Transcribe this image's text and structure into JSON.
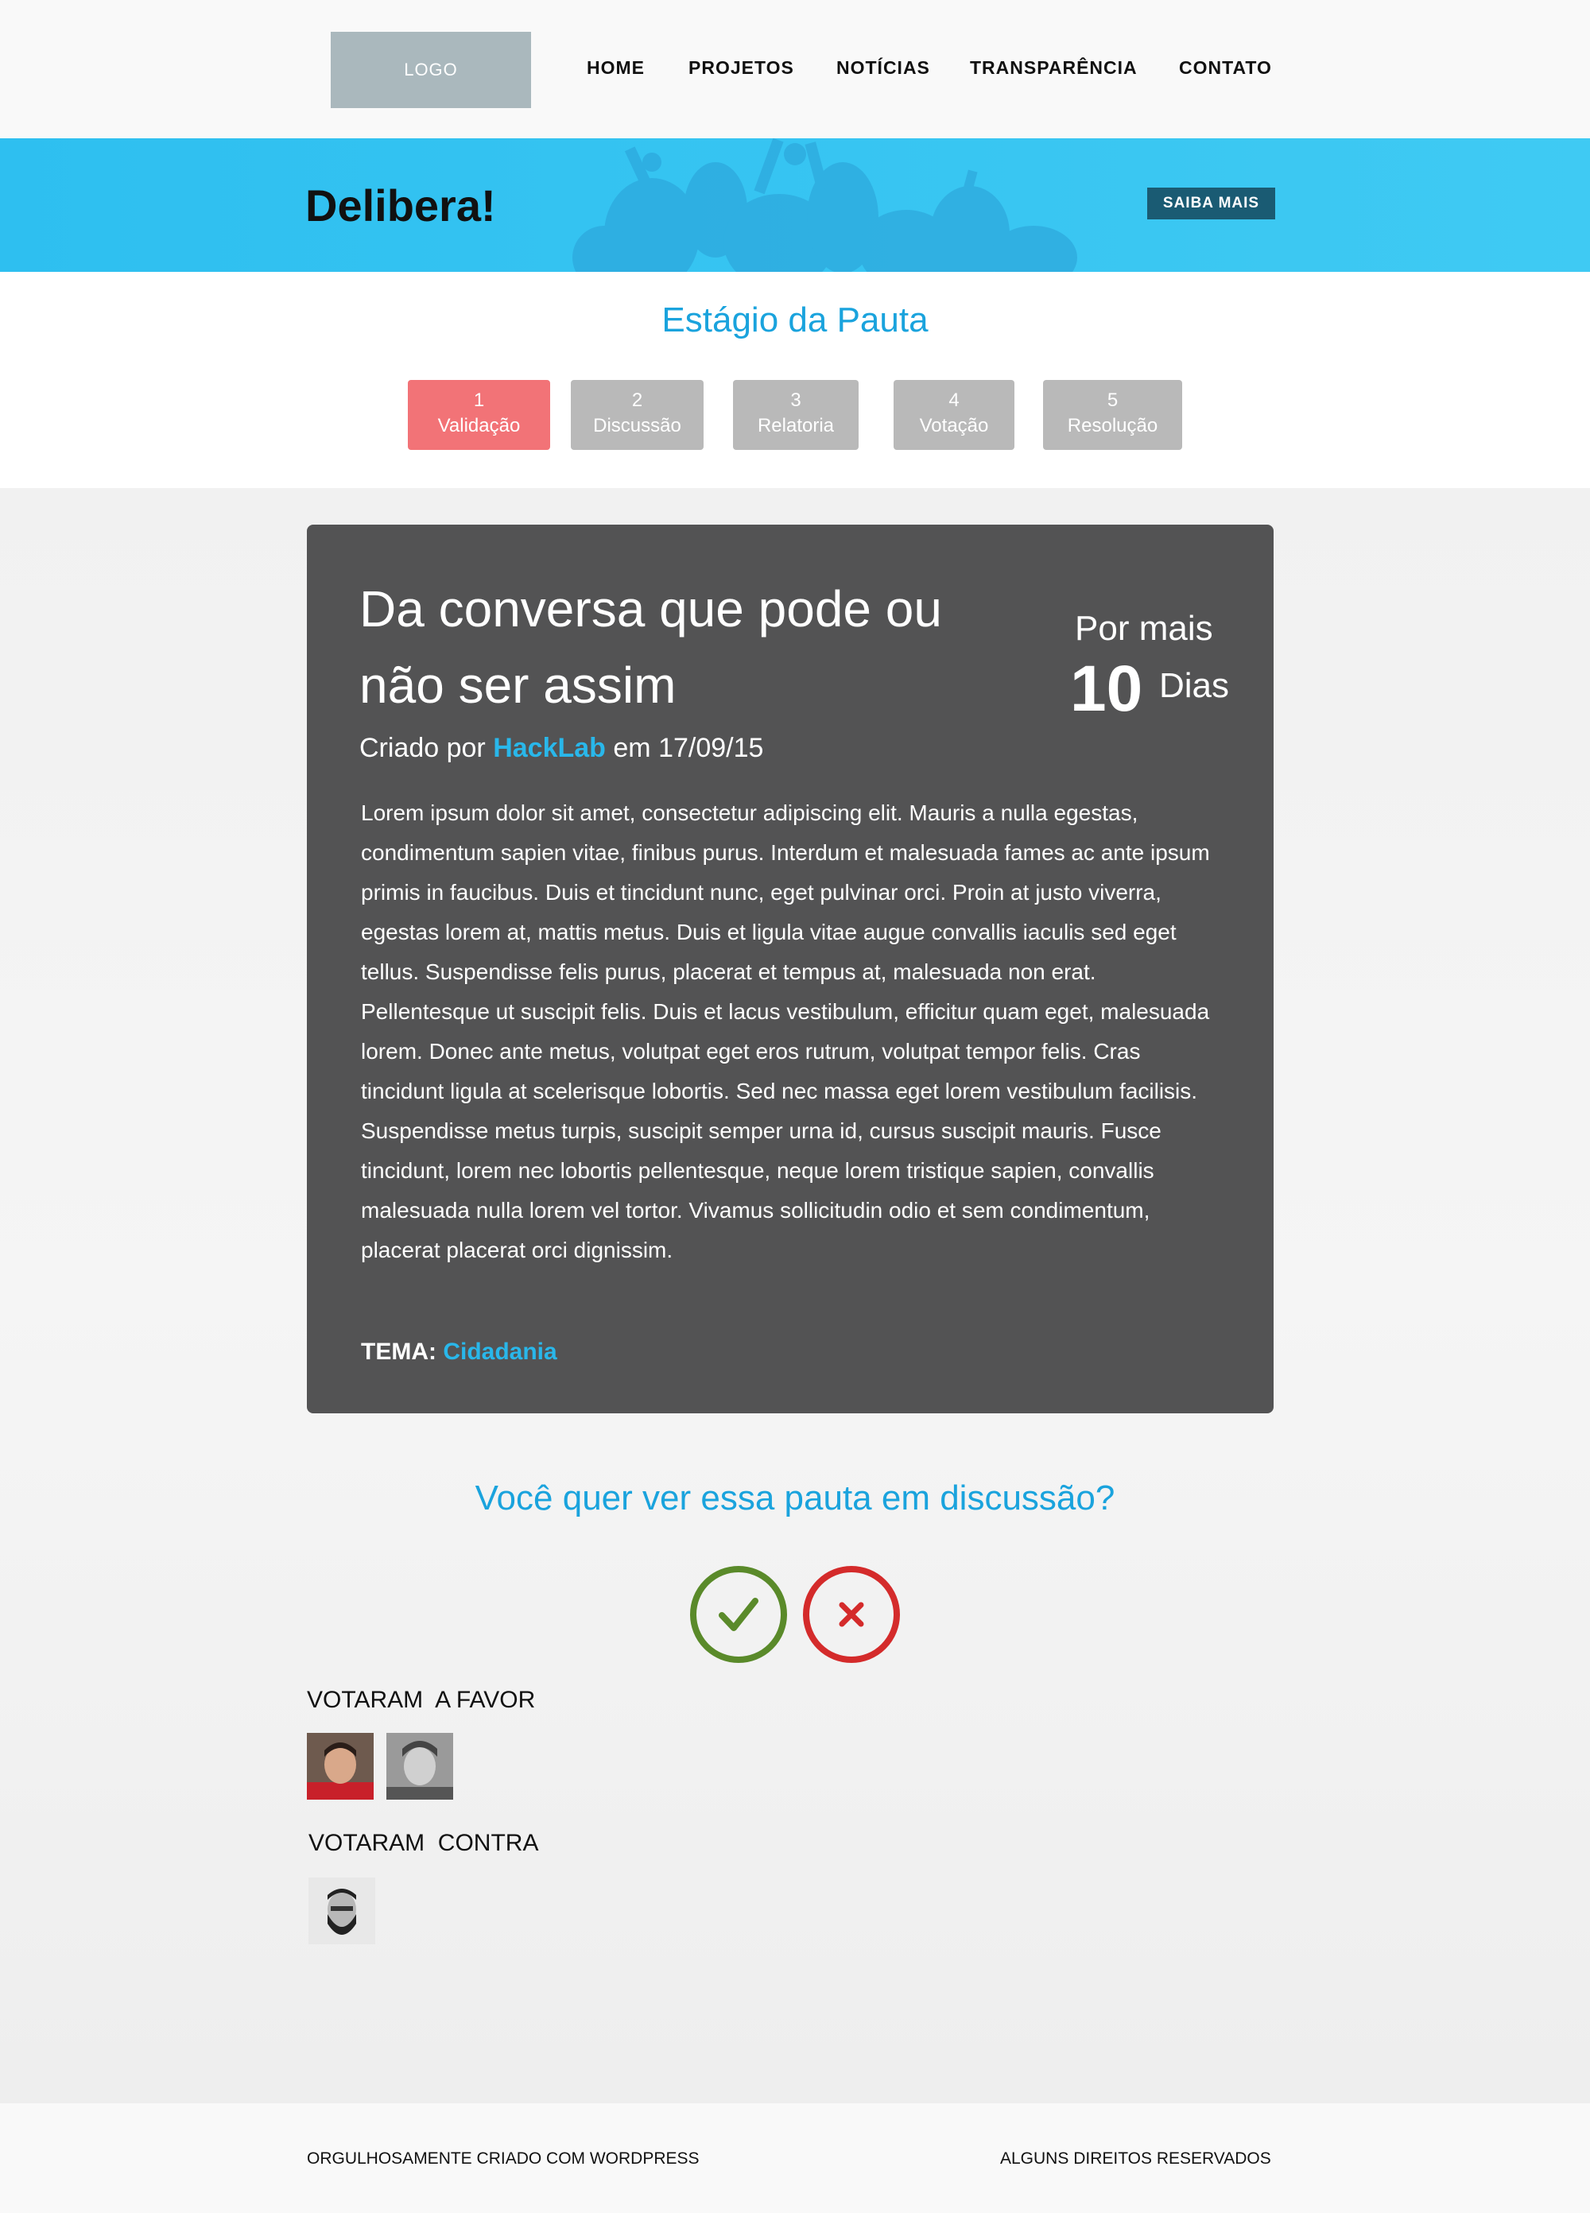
{
  "header": {
    "logo_text": "LOGO",
    "nav": [
      "HOME",
      "PROJETOS",
      "NOTÍCIAS",
      "TRANSPARÊNCIA",
      "CONTATO"
    ]
  },
  "banner": {
    "title": "Delibera!",
    "button_label": "SAIBA MAIS"
  },
  "stages": {
    "heading": "Estágio da Pauta",
    "items": [
      {
        "number": "1",
        "label": "Validação",
        "active": true
      },
      {
        "number": "2",
        "label": "Discussão",
        "active": false
      },
      {
        "number": "3",
        "label": "Relatoria",
        "active": false
      },
      {
        "number": "4",
        "label": "Votação",
        "active": false
      },
      {
        "number": "5",
        "label": "Resolução",
        "active": false
      }
    ]
  },
  "card": {
    "title": "Da conversa que pode ou não ser assim",
    "counter_label": "Por mais",
    "counter_value": "10",
    "counter_unit": "Dias",
    "created_prefix": "Criado por",
    "author": "HackLab",
    "created_suffix": "em 17/09/15",
    "body": "Lorem ipsum dolor sit amet, consectetur adipiscing elit. Mauris a nulla egestas, condimentum sapien vitae, finibus purus. Interdum et malesuada fames ac ante ipsum primis in faucibus. Duis et tincidunt nunc, eget pulvinar orci. Proin at justo viverra, egestas lorem at, mattis metus. Duis et ligula vitae augue convallis iaculis sed eget tellus. Suspendisse felis purus, placerat et tempus at, malesuada non erat. Pellentesque ut suscipit felis. Duis et lacus vestibulum, efficitur quam eget, malesuada lorem. Donec ante metus, volutpat eget eros rutrum, volutpat tempor felis. Cras tincidunt ligula at scelerisque lobortis. Sed nec massa eget lorem vestibulum facilisis. Suspendisse metus turpis, suscipit semper urna id, cursus suscipit mauris. Fusce tincidunt, lorem nec lobortis pellentesque, neque lorem tristique sapien, convallis malesuada nulla lorem vel tortor. Vivamus sollicitudin odio et sem condimentum, placerat placerat orci dignissim.",
    "tema_label": "TEMA:",
    "tema_value": "Cidadania"
  },
  "vote": {
    "question": "Você quer ver essa pauta em discussão?",
    "yes_icon": "check-icon",
    "no_icon": "x-icon",
    "yes_color": "#5a8a2a",
    "no_color": "#d42b2b"
  },
  "voters": {
    "favor_title": "VOTARAM  A FAVOR",
    "contra_title": "VOTARAM  CONTRA"
  },
  "footer": {
    "left": "ORGULHOSAMENTE CRIADO COM WORDPRESS",
    "right": "ALGUNS DIREITOS RESERVADOS"
  },
  "colors": {
    "accent": "#1aa3dd",
    "banner": "#3fcaf3",
    "active_stage": "#f27377",
    "inactive_stage": "#b9b9b9",
    "card_bg": "#535354"
  }
}
